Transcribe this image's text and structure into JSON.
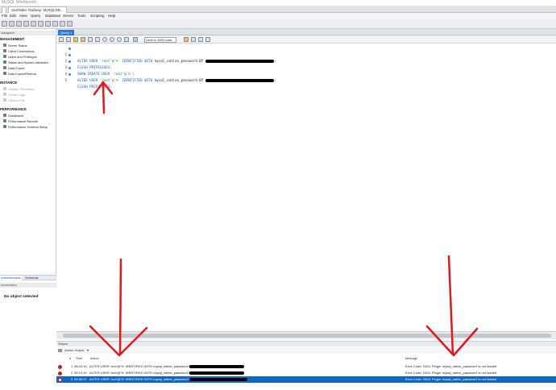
{
  "window": {
    "title": "MySQL Workbench"
  },
  "app_tabs": [
    {
      "label": "SeaTable: Railway: MySQLDB..."
    }
  ],
  "menu": [
    "File",
    "Edit",
    "View",
    "Query",
    "Database",
    "Server",
    "Tools",
    "Scripting",
    "Help"
  ],
  "navigator": {
    "header": "Navigator",
    "sections": [
      {
        "title": "MANAGEMENT",
        "items": [
          {
            "label": "Server Status",
            "icon": "server-icon"
          },
          {
            "label": "Client Connections",
            "icon": "connections-icon"
          },
          {
            "label": "Users and Privileges",
            "icon": "users-icon"
          },
          {
            "label": "Status and System Variables",
            "icon": "variables-icon"
          },
          {
            "label": "Data Export",
            "icon": "export-icon"
          },
          {
            "label": "Data Import/Restore",
            "icon": "import-icon"
          }
        ]
      },
      {
        "title": "INSTANCE",
        "items": [
          {
            "label": "Startup / Shutdown",
            "icon": "power-icon",
            "disabled": true
          },
          {
            "label": "Server Logs",
            "icon": "logs-icon",
            "disabled": true
          },
          {
            "label": "Options File",
            "icon": "wrench-icon",
            "disabled": true
          }
        ]
      },
      {
        "title": "PERFORMANCE",
        "items": [
          {
            "label": "Dashboard",
            "icon": "dashboard-icon"
          },
          {
            "label": "Performance Reports",
            "icon": "reports-icon"
          },
          {
            "label": "Performance Schema Setup",
            "icon": "schema-setup-icon"
          }
        ]
      }
    ],
    "bottom_tabs": [
      "Administration",
      "Schemas"
    ],
    "info_header": "Information",
    "no_object": "No object selected"
  },
  "editor": {
    "tab": "Query 1",
    "limit_label": "Limit to 1000 rows",
    "lines": [
      {
        "n": "1",
        "parts": [
          {
            "t": "ALTER USER ",
            "c": "kw"
          },
          {
            "t": "'root'@'%'",
            "c": "str"
          },
          {
            "t": " IDENTIFIED WITH ",
            "c": "kw"
          },
          {
            "t": "mysql_native_password BY ",
            "c": ""
          }
        ],
        "redact": 85,
        "tail": ";"
      },
      {
        "n": "2",
        "parts": [
          {
            "t": "FLUSH PRIVILEGES;",
            "c": "kw"
          }
        ]
      },
      {
        "n": "3",
        "parts": [
          {
            "t": "SHOW CREATE USER ",
            "c": "kw"
          },
          {
            "t": "'root'@'%'",
            "c": "str"
          },
          {
            "t": ";",
            "c": ""
          }
        ]
      },
      {
        "n": "4",
        "parts": [
          {
            "t": "ALTER USER ",
            "c": "kw"
          },
          {
            "t": "'root'@'%'",
            "c": "str"
          },
          {
            "t": " IDENTIFIED WITH ",
            "c": "kw"
          },
          {
            "t": "mysql_native_password BY ",
            "c": ""
          }
        ],
        "redact": 85,
        "tail": ";"
      },
      {
        "n": "5",
        "parts": [
          {
            "t": "FLUSH PRIVILEGES;",
            "c": "kw"
          }
        ]
      }
    ]
  },
  "output": {
    "header": "Output",
    "selector": "Action Output",
    "columns": {
      "num": "#",
      "time": "Time",
      "action": "Action",
      "message": "Message"
    },
    "rows": [
      {
        "num": "1",
        "time": "08:43:15",
        "action": "ALTER USER 'root'@'%' IDENTIFIED WITH mysql_native_password BY",
        "message": "Error Code: 1524. Plugin 'mysql_native_password' is not loaded"
      },
      {
        "num": "2",
        "time": "09:13:19",
        "action": "ALTER USER 'root'@'%' IDENTIFIED WITH mysql_native_password BY",
        "message": "Error Code: 1524. Plugin 'mysql_native_password' is not loaded"
      },
      {
        "num": "3",
        "time": "04:58:37",
        "action": "ALTER USER 'root'@'%' IDENTIFIED WITH mysql_native_password BY",
        "message": "Error Code: 1524. Plugin 'mysql_native_password' is not loaded",
        "selected": true
      }
    ]
  },
  "colors": {
    "accent": "#2b78d0",
    "error": "#c81d1d",
    "annotation": "#e0191c"
  }
}
